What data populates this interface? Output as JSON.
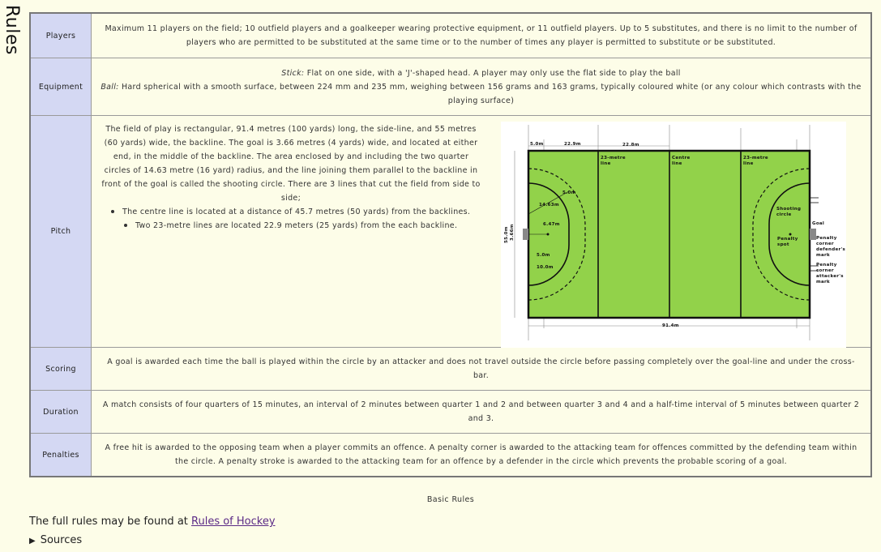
{
  "side_title": "Rules",
  "rows": {
    "players": {
      "label": "Players",
      "text": "Maximum 11 players on the field; 10 outfield players and a goalkeeper wearing protective equipment, or 11 outfield players. Up to 5 substitutes, and there is no limit to the number of players who are permitted to be substituted at the same time or to the number of times any player is permitted to substitute or be substituted."
    },
    "equipment": {
      "label": "Equipment",
      "stick_label": "Stick:",
      "stick_text": " Flat on one side, with a 'J'-shaped head. A player may only use the flat side to play the ball",
      "ball_label": "Ball:",
      "ball_text": " Hard spherical with a smooth surface, between 224 mm and 235 mm, weighing between 156 grams and 163 grams, typically coloured white (or any colour which contrasts with the playing surface)"
    },
    "pitch": {
      "label": "Pitch",
      "text": "The field of play is rectangular, 91.4 metres (100 yards) long, the side-line, and 55 metres (60 yards) wide, the backline. The goal is 3.66 metres (4 yards) wide, and located at either end, in the middle of the backline. The area enclosed by and including the two quarter circles of 14.63 metre (16 yard) radius, and the line joining them parallel to the backline in front of the goal is called the shooting circle. There are 3 lines that cut the field from side to side;",
      "bullet1": "The centre line is located at a distance of 45.7 metres (50 yards) from the backlines.",
      "bullet2": "Two 23-metre lines are located 22.9 meters (25 yards) from the each backline.",
      "diagram": {
        "dim_5m": "5.0m",
        "dim_229": "22.9m",
        "dim_228": "22.8m",
        "line_23_a": "23-metre",
        "line_23_b": "line",
        "centre_a": "Centre",
        "centre_b": "line",
        "line_23r_a": "23-metre",
        "line_23r_b": "line",
        "r1463": "14.63m",
        "r5_top": "5.0m",
        "d647": "6.47m",
        "w55": "55.0m",
        "w366": "3.66m",
        "d5": "5.0m",
        "d10": "10.0m",
        "shoot_a": "Shooting",
        "shoot_b": "circle",
        "goal": "Goal",
        "pen_a": "Penalty",
        "pen_b": "spot",
        "pcd_a": "Penalty",
        "pcd_b": "corner",
        "pcd_c": "defender's",
        "pcd_d": "mark",
        "pca_a": "Penalty",
        "pca_b": "corner",
        "pca_c": "attacker's",
        "pca_d": "mark",
        "length": "91.4m",
        "grass_color": "#92d24a"
      }
    },
    "scoring": {
      "label": "Scoring",
      "text": "A goal is awarded each time the ball is played within the circle by an attacker and does not travel outside the circle before passing completely over the goal-line and under the cross-bar."
    },
    "duration": {
      "label": "Duration",
      "text": "A match consists of four quarters of 15 minutes, an interval of 2 minutes between quarter 1 and 2 and between quarter 3 and 4 and a half-time interval of 5 minutes between quarter 2 and 3."
    },
    "penalties": {
      "label": "Penalties",
      "text": "A free hit is awarded to the opposing team when a player commits an offence. A penalty corner is awarded to the attacking team for offences committed by the defending team within the circle. A penalty stroke is awarded to the attacking team for an offence by a defender in the circle which prevents the probable scoring of a goal."
    }
  },
  "caption": "Basic Rules",
  "full_rules_prefix": "The full rules may be found at ",
  "full_rules_link": "Rules of Hockey",
  "sources_toggle": "▶",
  "sources_label": "Sources",
  "colors": {
    "label_bg": "#d4d8f3",
    "page_bg": "#fdfde8",
    "link": "#5b2a86"
  }
}
